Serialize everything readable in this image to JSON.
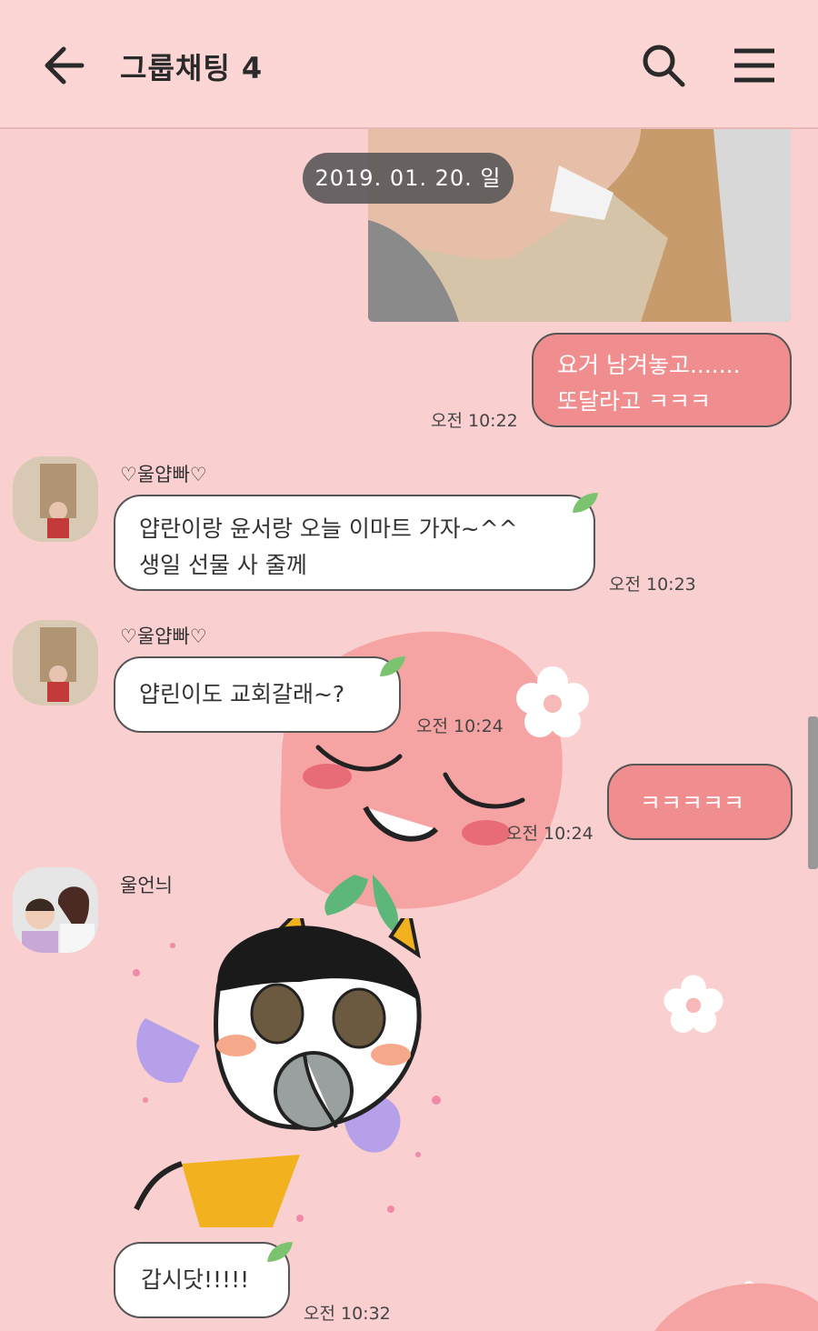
{
  "header": {
    "title": "그룹채팅 4"
  },
  "icons": {
    "back": "arrow-left-icon",
    "search": "search-icon",
    "menu": "hamburger-menu-icon"
  },
  "colors": {
    "background": "#f9cfcf",
    "header_bg": "#fbd6d4",
    "my_bubble": "#f08d8f",
    "their_bubble": "#ffffff",
    "date_pill": "#505054"
  },
  "chat": {
    "date_divider": "2019. 01. 20. 일",
    "messages": [
      {
        "id": "m1",
        "from": "me",
        "lines": [
          "요거 남겨놓고.......",
          "또달라고 ㅋㅋㅋ"
        ],
        "time": "오전 10:22"
      },
      {
        "id": "m2",
        "from": "♡울얍빠♡",
        "lines": [
          "얍란이랑 윤서랑 오늘 이마트 가자~^^",
          "생일 선물 사 줄께"
        ],
        "time": "오전 10:23"
      },
      {
        "id": "m3",
        "from": "♡울얍빠♡",
        "lines": [
          "얍린이도 교회갈래~?"
        ],
        "time": "오전 10:24"
      },
      {
        "id": "m4",
        "from": "me",
        "lines": [
          "ㅋㅋㅋㅋㅋ"
        ],
        "time": "오전 10:24"
      },
      {
        "id": "m5",
        "from": "울언늬",
        "lines": [
          "갑시닷!!!!!"
        ],
        "time": "오전 10:32"
      }
    ]
  }
}
